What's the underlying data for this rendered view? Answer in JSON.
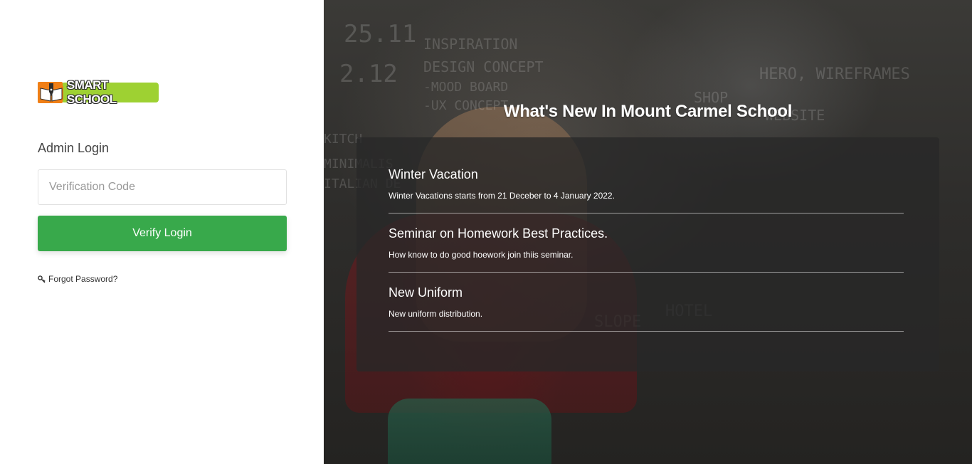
{
  "logo": {
    "text": "SMART SCHOOL"
  },
  "login": {
    "title": "Admin Login",
    "code_placeholder": "Verification Code",
    "code_value": "",
    "verify_label": "Verify Login",
    "forgot_label": "Forgot Password?",
    "forgot_icon": "key-icon"
  },
  "news": {
    "heading": "What's New In Mount Carmel School",
    "items": [
      {
        "title": "Winter Vacation",
        "text": "Winter Vacations starts from 21 Deceber to 4 January 2022."
      },
      {
        "title": "Seminar on Homework Best Practices.",
        "text": "How know to do good hoework join thiis seminar."
      },
      {
        "title": "New Uniform",
        "text": "New uniform distribution."
      }
    ]
  },
  "colors": {
    "primary_button": "#38a94b",
    "logo_orange": "#f07f16",
    "logo_green": "#9ed132"
  }
}
